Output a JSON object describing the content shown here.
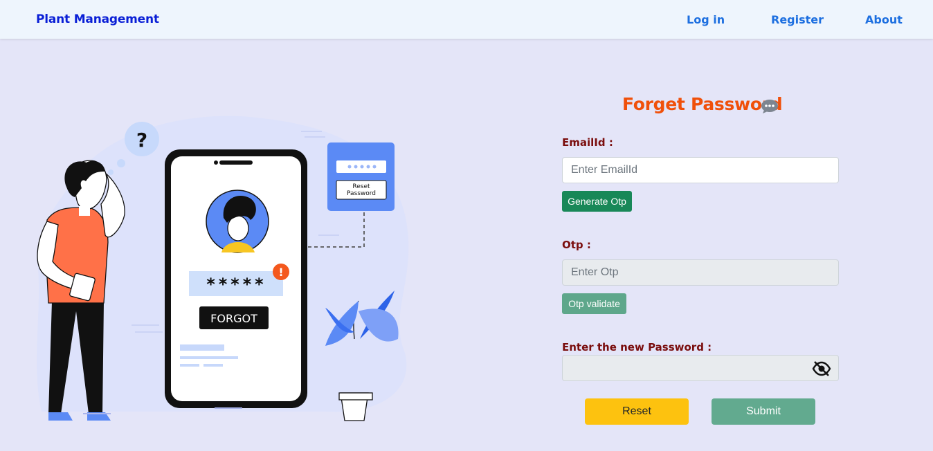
{
  "navbar": {
    "brand": "Plant Management",
    "links": [
      "Log in",
      "Register",
      "About"
    ]
  },
  "illustration": {
    "question_mark": "?",
    "password_mask": "*****",
    "forgot_label": "FORGOT",
    "reset_card_line1": "Reset",
    "reset_card_line2": "Password",
    "alert": "!"
  },
  "form": {
    "title": "Forget Password",
    "title_icon": "chat-bubble-icon",
    "email_label": "EmailId :",
    "email_placeholder": "Enter EmailId",
    "generate_otp_label": "Generate Otp",
    "otp_label": "Otp :",
    "otp_placeholder": "Enter Otp",
    "otp_validate_label": "Otp validate",
    "new_password_label": "Enter the new Password :",
    "new_password_value": "",
    "password_toggle_icon": "eye-slash-icon",
    "reset_label": "Reset",
    "submit_label": "Submit"
  },
  "colors": {
    "background": "#e4e5f8",
    "navbar": "#eef5fd",
    "brand": "#0a1fd6",
    "nav_link": "#1d6fe0",
    "title": "#f0500a",
    "label": "#7a0d0d",
    "generate_button": "#188858",
    "validate_button": "#5ea78b",
    "reset_button": "#fdc20f",
    "submit_button": "#62aa8f"
  }
}
